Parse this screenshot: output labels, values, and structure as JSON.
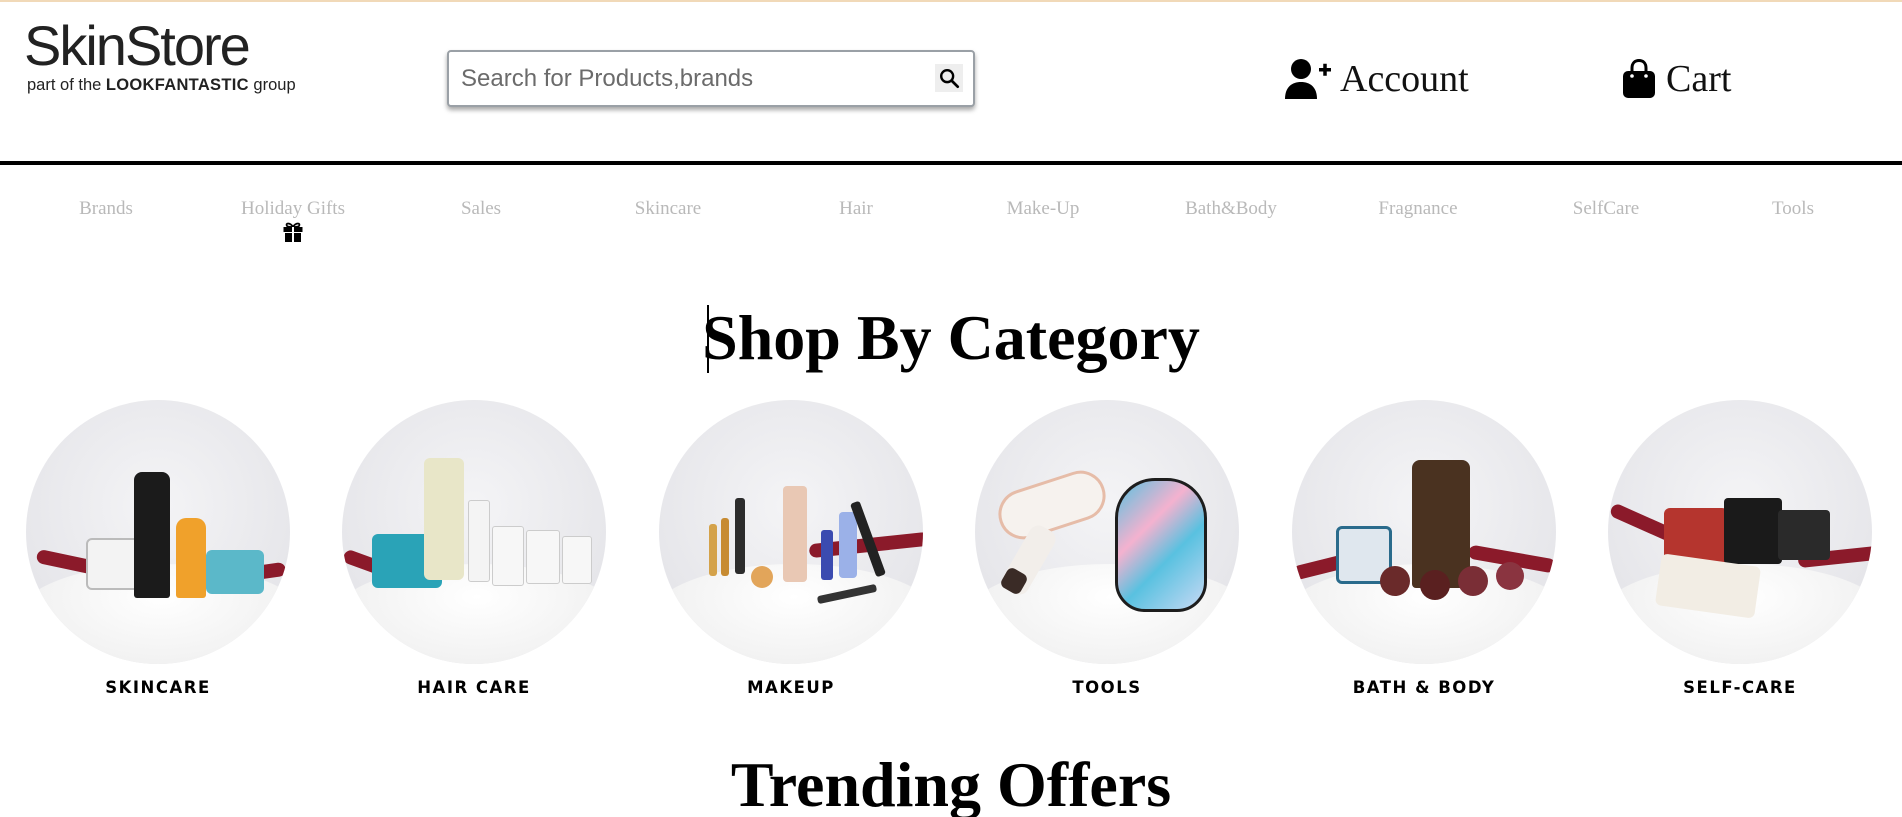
{
  "header": {
    "logo_main": "SkinStore",
    "logo_sub_prefix": "part of the",
    "logo_sub_brand": "LOOKFANTASTIC",
    "logo_sub_suffix": "group",
    "search_placeholder": "Search for Products,brands",
    "account_label": "Account",
    "cart_label": "Cart"
  },
  "nav": {
    "items": [
      "Brands",
      "Holiday Gifts",
      "Sales",
      "Skincare",
      "Hair",
      "Make-Up",
      "Bath&Body",
      "Fragnance",
      "SelfCare",
      "Tools"
    ]
  },
  "shop_by_category": {
    "title": "Shop By Category",
    "categories": [
      "SKINCARE",
      "HAIR CARE",
      "MAKEUP",
      "TOOLS",
      "BATH & BODY",
      "SELF-CARE"
    ]
  },
  "trending": {
    "title": "Trending Offers"
  },
  "colors": {
    "nav_text": "#b9b9b9",
    "header_rule": "#000000",
    "ribbon": "#8b1a2a"
  },
  "icons": [
    "search-icon",
    "add-user-icon",
    "shopping-bag-icon",
    "gift-icon"
  ]
}
